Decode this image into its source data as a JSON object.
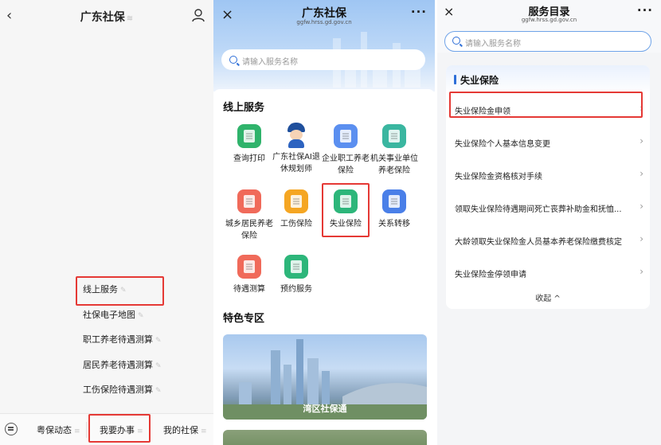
{
  "panel1": {
    "title": "广东社保",
    "title_mark": "≋",
    "back_glyph": "‹",
    "submenu": [
      {
        "label": "线上服务"
      },
      {
        "label": "社保电子地图"
      },
      {
        "label": "职工养老待遇测算"
      },
      {
        "label": "居民养老待遇测算"
      },
      {
        "label": "工伤保险待遇测算"
      }
    ],
    "edit_glyph": "✎",
    "tabs": [
      {
        "label": "粤保动态",
        "mark": "≡"
      },
      {
        "label": "我要办事",
        "mark": "≡"
      },
      {
        "label": "我的社保",
        "mark": "≡"
      }
    ]
  },
  "panel2": {
    "title": "广东社保",
    "domain": "ggfw.hrss.gd.gov.cn",
    "close_glyph": "×",
    "more_glyph": "···",
    "search_placeholder": "请输入服务名称",
    "online_section_title": "线上服务",
    "services": [
      {
        "label": "查询打印",
        "color": "#2fb36b",
        "icon": "printer-icon"
      },
      {
        "label": "广东社保AI退休规划师",
        "color": "",
        "icon": "ai-avatar-icon"
      },
      {
        "label": "企业职工养老保险",
        "color": "#5b8ff0",
        "icon": "pension-icon"
      },
      {
        "label": "机关事业单位养老保险",
        "color": "#3ab6a0",
        "icon": "institution-icon"
      },
      {
        "label": "城乡居民养老保险",
        "color": "#f06a5a",
        "icon": "resident-icon"
      },
      {
        "label": "工伤保险",
        "color": "#f5a623",
        "icon": "injury-icon"
      },
      {
        "label": "失业保险",
        "color": "#2db67a",
        "icon": "unemployment-icon"
      },
      {
        "label": "关系转移",
        "color": "#4a7fe8",
        "icon": "transfer-icon"
      },
      {
        "label": "待遇测算",
        "color": "#f06a5a",
        "icon": "calculator-icon"
      },
      {
        "label": "预约服务",
        "color": "#2db67a",
        "icon": "appointment-icon"
      }
    ],
    "special_section_title": "特色专区",
    "banner_caption": "湾区社保通"
  },
  "panel3": {
    "title": "服务目录",
    "domain": "ggfw.hrss.gd.gov.cn",
    "close_glyph": "×",
    "more_glyph": "···",
    "search_placeholder": "请输入服务名称",
    "category_title": "失业保险",
    "items": [
      {
        "label": "失业保险金申领"
      },
      {
        "label": "失业保险个人基本信息变更"
      },
      {
        "label": "失业保险金资格核对手续"
      },
      {
        "label": "领取失业保险待遇期间死亡丧葬补助金和抚恤..."
      },
      {
        "label": "大龄领取失业保险金人员基本养老保险缴费核定"
      },
      {
        "label": "失业保险金停领申请"
      }
    ],
    "chevron_glyph": "›",
    "collapse_label": "收起 ^"
  },
  "colors": {
    "accent": "#2e6fd8",
    "highlight": "#e53935"
  }
}
